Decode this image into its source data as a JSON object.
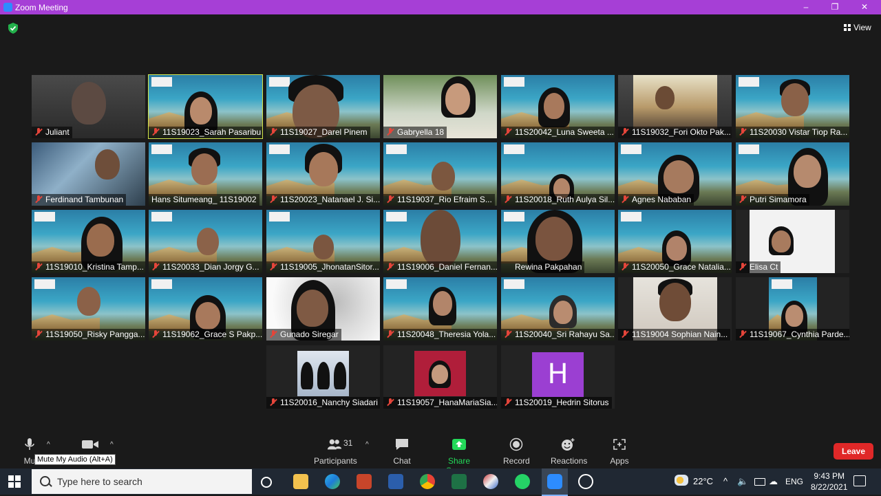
{
  "window": {
    "title": "Zoom Meeting",
    "controls": [
      "–",
      "❐",
      "✕"
    ]
  },
  "header": {
    "view_label": "View"
  },
  "participants": [
    "Juliant",
    "11S19023_Sarah Pasaribu",
    "11S19027_Darel Pinem",
    "Gabryella 18",
    "11S20042_Luna Sweeta ...",
    "11S19032_Fori Okto Pak...",
    "11S20030 Vistar Tiop Ra...",
    "Ferdinand Tambunan",
    "Hans Situmeang_ 11S19002",
    "11S20023_Natanael J. Si...",
    "11S19037_Rio Efraim S...",
    "11S20018_Ruth Aulya Sil...",
    "Agnes Nababan",
    "Putri Simamora",
    "11S19010_Kristina Tamp...",
    "11S20033_Dian Jorgy G...",
    "11S19005_JhonatanSitor...",
    "11S19006_Daniel Fernan...",
    "Rewina Pakpahan",
    "11S20050_Grace Natalia...",
    "Elisa Ct",
    "11S19050_Risky Pangga...",
    "11S19062_Grace S Pakp...",
    "Gunado Siregar",
    "11S20048_Theresia Yola...",
    "11S20040_Sri Rahayu Sa...",
    "11S19004 Sophian Nain...",
    "11S19067_Cynthia Parde...",
    "11S20016_Nanchy Siadari",
    "11S19057_HanaMariaSia...",
    "11S20019_Hedrin Sitorus"
  ],
  "avatar_letter": "H",
  "toolbar": {
    "mute_label": "Mu",
    "tooltip": "Mute My Audio (Alt+A)",
    "participants_label": "Participants",
    "participants_count": "31",
    "chat_label": "Chat",
    "share_label": "Share Screen",
    "record_label": "Record",
    "reactions_label": "Reactions",
    "apps_label": "Apps",
    "leave_label": "Leave"
  },
  "taskbar": {
    "search_placeholder": "Type here to search",
    "weather": "22°C",
    "language": "ENG",
    "time": "9:43 PM",
    "date": "8/22/2021"
  },
  "colors": {
    "titlebar": "#a63fd6",
    "leave": "#e02828",
    "share": "#23d959",
    "active_outline": "#d5e84a",
    "muted": "#e5453a"
  }
}
